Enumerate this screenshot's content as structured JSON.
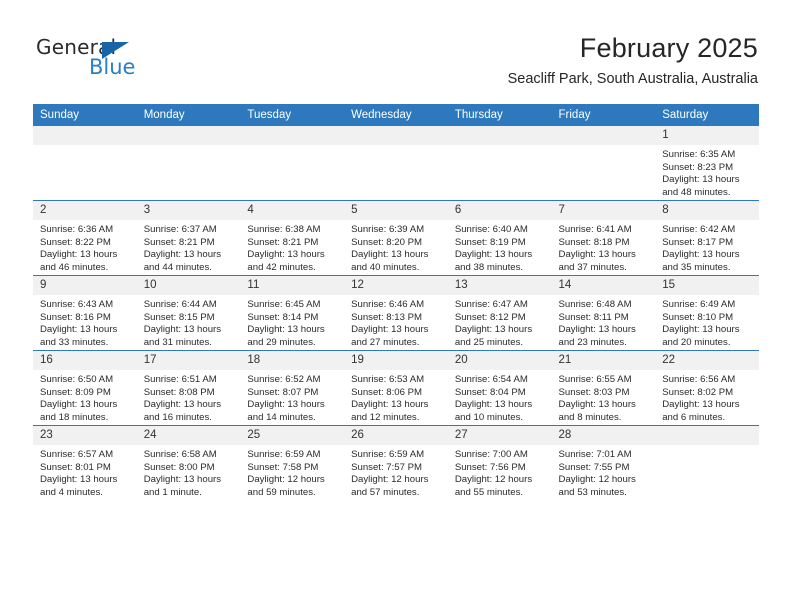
{
  "brand": {
    "name_dark": "General",
    "name_blue": "Blue",
    "accent_color": "#2a7fc9",
    "triangle_color": "#1565a8"
  },
  "header": {
    "title": "February 2025",
    "location": "Seacliff Park, South Australia, Australia"
  },
  "calendar": {
    "header_bg": "#2e78bd",
    "daynum_bg": "#f1f1f1",
    "weekdays": [
      "Sunday",
      "Monday",
      "Tuesday",
      "Wednesday",
      "Thursday",
      "Friday",
      "Saturday"
    ],
    "weeks": [
      [
        {
          "day": "",
          "sunrise": "",
          "sunset": "",
          "daylight": "",
          "daylight2": ""
        },
        {
          "day": "",
          "sunrise": "",
          "sunset": "",
          "daylight": "",
          "daylight2": ""
        },
        {
          "day": "",
          "sunrise": "",
          "sunset": "",
          "daylight": "",
          "daylight2": ""
        },
        {
          "day": "",
          "sunrise": "",
          "sunset": "",
          "daylight": "",
          "daylight2": ""
        },
        {
          "day": "",
          "sunrise": "",
          "sunset": "",
          "daylight": "",
          "daylight2": ""
        },
        {
          "day": "",
          "sunrise": "",
          "sunset": "",
          "daylight": "",
          "daylight2": ""
        },
        {
          "day": "1",
          "sunrise": "Sunrise: 6:35 AM",
          "sunset": "Sunset: 8:23 PM",
          "daylight": "Daylight: 13 hours",
          "daylight2": "and 48 minutes."
        }
      ],
      [
        {
          "day": "2",
          "sunrise": "Sunrise: 6:36 AM",
          "sunset": "Sunset: 8:22 PM",
          "daylight": "Daylight: 13 hours",
          "daylight2": "and 46 minutes."
        },
        {
          "day": "3",
          "sunrise": "Sunrise: 6:37 AM",
          "sunset": "Sunset: 8:21 PM",
          "daylight": "Daylight: 13 hours",
          "daylight2": "and 44 minutes."
        },
        {
          "day": "4",
          "sunrise": "Sunrise: 6:38 AM",
          "sunset": "Sunset: 8:21 PM",
          "daylight": "Daylight: 13 hours",
          "daylight2": "and 42 minutes."
        },
        {
          "day": "5",
          "sunrise": "Sunrise: 6:39 AM",
          "sunset": "Sunset: 8:20 PM",
          "daylight": "Daylight: 13 hours",
          "daylight2": "and 40 minutes."
        },
        {
          "day": "6",
          "sunrise": "Sunrise: 6:40 AM",
          "sunset": "Sunset: 8:19 PM",
          "daylight": "Daylight: 13 hours",
          "daylight2": "and 38 minutes."
        },
        {
          "day": "7",
          "sunrise": "Sunrise: 6:41 AM",
          "sunset": "Sunset: 8:18 PM",
          "daylight": "Daylight: 13 hours",
          "daylight2": "and 37 minutes."
        },
        {
          "day": "8",
          "sunrise": "Sunrise: 6:42 AM",
          "sunset": "Sunset: 8:17 PM",
          "daylight": "Daylight: 13 hours",
          "daylight2": "and 35 minutes."
        }
      ],
      [
        {
          "day": "9",
          "sunrise": "Sunrise: 6:43 AM",
          "sunset": "Sunset: 8:16 PM",
          "daylight": "Daylight: 13 hours",
          "daylight2": "and 33 minutes."
        },
        {
          "day": "10",
          "sunrise": "Sunrise: 6:44 AM",
          "sunset": "Sunset: 8:15 PM",
          "daylight": "Daylight: 13 hours",
          "daylight2": "and 31 minutes."
        },
        {
          "day": "11",
          "sunrise": "Sunrise: 6:45 AM",
          "sunset": "Sunset: 8:14 PM",
          "daylight": "Daylight: 13 hours",
          "daylight2": "and 29 minutes."
        },
        {
          "day": "12",
          "sunrise": "Sunrise: 6:46 AM",
          "sunset": "Sunset: 8:13 PM",
          "daylight": "Daylight: 13 hours",
          "daylight2": "and 27 minutes."
        },
        {
          "day": "13",
          "sunrise": "Sunrise: 6:47 AM",
          "sunset": "Sunset: 8:12 PM",
          "daylight": "Daylight: 13 hours",
          "daylight2": "and 25 minutes."
        },
        {
          "day": "14",
          "sunrise": "Sunrise: 6:48 AM",
          "sunset": "Sunset: 8:11 PM",
          "daylight": "Daylight: 13 hours",
          "daylight2": "and 23 minutes."
        },
        {
          "day": "15",
          "sunrise": "Sunrise: 6:49 AM",
          "sunset": "Sunset: 8:10 PM",
          "daylight": "Daylight: 13 hours",
          "daylight2": "and 20 minutes."
        }
      ],
      [
        {
          "day": "16",
          "sunrise": "Sunrise: 6:50 AM",
          "sunset": "Sunset: 8:09 PM",
          "daylight": "Daylight: 13 hours",
          "daylight2": "and 18 minutes."
        },
        {
          "day": "17",
          "sunrise": "Sunrise: 6:51 AM",
          "sunset": "Sunset: 8:08 PM",
          "daylight": "Daylight: 13 hours",
          "daylight2": "and 16 minutes."
        },
        {
          "day": "18",
          "sunrise": "Sunrise: 6:52 AM",
          "sunset": "Sunset: 8:07 PM",
          "daylight": "Daylight: 13 hours",
          "daylight2": "and 14 minutes."
        },
        {
          "day": "19",
          "sunrise": "Sunrise: 6:53 AM",
          "sunset": "Sunset: 8:06 PM",
          "daylight": "Daylight: 13 hours",
          "daylight2": "and 12 minutes."
        },
        {
          "day": "20",
          "sunrise": "Sunrise: 6:54 AM",
          "sunset": "Sunset: 8:04 PM",
          "daylight": "Daylight: 13 hours",
          "daylight2": "and 10 minutes."
        },
        {
          "day": "21",
          "sunrise": "Sunrise: 6:55 AM",
          "sunset": "Sunset: 8:03 PM",
          "daylight": "Daylight: 13 hours",
          "daylight2": "and 8 minutes."
        },
        {
          "day": "22",
          "sunrise": "Sunrise: 6:56 AM",
          "sunset": "Sunset: 8:02 PM",
          "daylight": "Daylight: 13 hours",
          "daylight2": "and 6 minutes."
        }
      ],
      [
        {
          "day": "23",
          "sunrise": "Sunrise: 6:57 AM",
          "sunset": "Sunset: 8:01 PM",
          "daylight": "Daylight: 13 hours",
          "daylight2": "and 4 minutes."
        },
        {
          "day": "24",
          "sunrise": "Sunrise: 6:58 AM",
          "sunset": "Sunset: 8:00 PM",
          "daylight": "Daylight: 13 hours",
          "daylight2": "and 1 minute."
        },
        {
          "day": "25",
          "sunrise": "Sunrise: 6:59 AM",
          "sunset": "Sunset: 7:58 PM",
          "daylight": "Daylight: 12 hours",
          "daylight2": "and 59 minutes."
        },
        {
          "day": "26",
          "sunrise": "Sunrise: 6:59 AM",
          "sunset": "Sunset: 7:57 PM",
          "daylight": "Daylight: 12 hours",
          "daylight2": "and 57 minutes."
        },
        {
          "day": "27",
          "sunrise": "Sunrise: 7:00 AM",
          "sunset": "Sunset: 7:56 PM",
          "daylight": "Daylight: 12 hours",
          "daylight2": "and 55 minutes."
        },
        {
          "day": "28",
          "sunrise": "Sunrise: 7:01 AM",
          "sunset": "Sunset: 7:55 PM",
          "daylight": "Daylight: 12 hours",
          "daylight2": "and 53 minutes."
        },
        {
          "day": "",
          "sunrise": "",
          "sunset": "",
          "daylight": "",
          "daylight2": ""
        }
      ]
    ]
  }
}
